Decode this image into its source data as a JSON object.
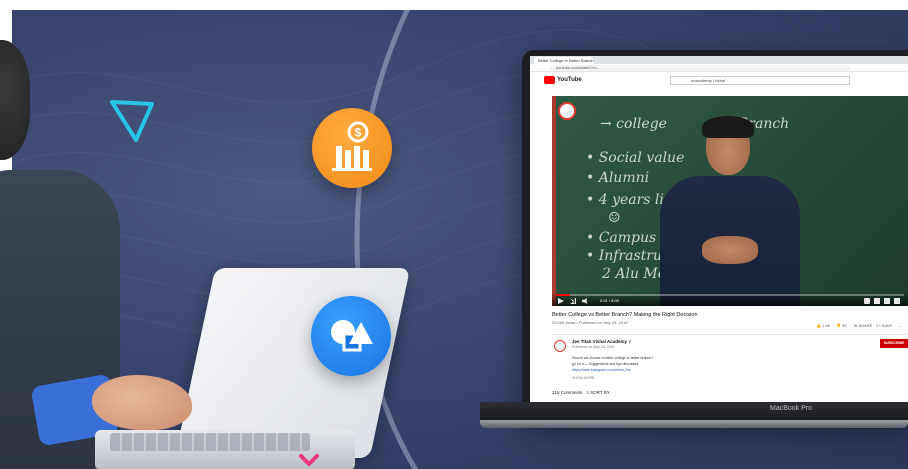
{
  "browser": {
    "tab_title": "Better College or Better Branch?",
    "address": "youtube.com/watch?v=..."
  },
  "youtube": {
    "logo_text": "YouTube",
    "search_value": "unacademy | vishal"
  },
  "chalkboard": {
    "lines": [
      "→ college",
      "Branch",
      "• Social value",
      "• Alumni",
      "• 4 years life",
      "☺",
      "• Campus",
      "• Infrastructure",
      "2 Alu Money"
    ]
  },
  "player": {
    "time": "0:01 / 8:06",
    "progress_fraction": 0.04
  },
  "video": {
    "title": "Better College vs Better Branch? Making the Right Decision",
    "meta": "20,069 views • Published on May 25, 2019",
    "actions": [
      "👍 1.4K",
      "👎 30",
      "➦ SHARE",
      "≡+ SAVE",
      "..."
    ]
  },
  "channel": {
    "name": "Jee Titan Vishal Academy ✓",
    "subscribers": "Published on May 25, 2019",
    "subscribe_label": "SUBSCRIBE",
    "description": [
      "Should we choose a better college or better branch?",
      "go for it — Suggestions and tips discussed",
      "https://www.instagram.com/vishal_the",
      "SHOW MORE"
    ]
  },
  "comments": {
    "label": "215 Comments",
    "sort": "≡ SORT BY"
  },
  "laptop": {
    "brand_label": "MacBook Pro"
  },
  "colors": {
    "orange_badge": "#f28b16",
    "blue_badge": "#1673e0",
    "youtube_red": "#ff0000",
    "triangle": "#29c5e6",
    "x_mark": "#e8387a"
  }
}
